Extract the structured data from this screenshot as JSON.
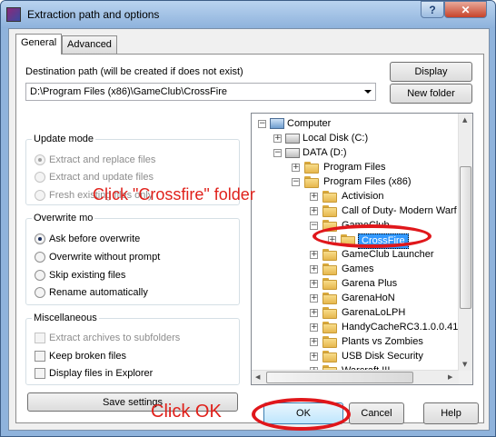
{
  "window": {
    "title": "Extraction path and options",
    "help_label": "?",
    "close_label": "✕"
  },
  "tabs": [
    {
      "label": "General",
      "active": true
    },
    {
      "label": "Advanced",
      "active": false
    }
  ],
  "destination": {
    "label": "Destination path (will be created if does not exist)",
    "value": "D:\\Program Files (x86)\\GameClub\\CrossFire"
  },
  "buttons": {
    "display": "Display",
    "new_folder": "New folder",
    "save_settings": "Save settings",
    "ok": "OK",
    "cancel": "Cancel",
    "help": "Help"
  },
  "update_mode": {
    "title": "Update mode",
    "options": [
      {
        "label": "Extract and replace files",
        "selected": true,
        "enabled": false
      },
      {
        "label": "Extract and update files",
        "selected": false,
        "enabled": false
      },
      {
        "label": "Fresh existing files only",
        "selected": false,
        "enabled": false
      }
    ]
  },
  "overwrite_mode": {
    "title": "Overwrite mo",
    "options": [
      {
        "label": "Ask before overwrite",
        "selected": true
      },
      {
        "label": "Overwrite without prompt",
        "selected": false
      },
      {
        "label": "Skip existing files",
        "selected": false
      },
      {
        "label": "Rename automatically",
        "selected": false
      }
    ]
  },
  "miscellaneous": {
    "title": "Miscellaneous",
    "options": [
      {
        "label": "Extract archives to subfolders",
        "checked": false,
        "enabled": false
      },
      {
        "label": "Keep broken files",
        "checked": false,
        "enabled": true
      },
      {
        "label": "Display files in Explorer",
        "checked": false,
        "enabled": true
      }
    ]
  },
  "tree": {
    "items": [
      {
        "label": "Computer",
        "icon": "computer-icon"
      },
      {
        "label": "Local Disk (C:)",
        "icon": "drive-icon"
      },
      {
        "label": "DATA (D:)",
        "icon": "drive-icon"
      },
      {
        "label": "Program Files",
        "icon": "folder-icon"
      },
      {
        "label": "Program Files (x86)",
        "icon": "folder-icon"
      },
      {
        "label": "Activision",
        "icon": "folder-icon"
      },
      {
        "label": "Call of Duty- Modern Warf",
        "icon": "folder-icon"
      },
      {
        "label": "GameClub",
        "icon": "folder-icon"
      },
      {
        "label": "CrossFire",
        "icon": "folder-icon",
        "selected": true
      },
      {
        "label": "GameClub Launcher",
        "icon": "folder-icon"
      },
      {
        "label": "Games",
        "icon": "folder-icon"
      },
      {
        "label": "Garena Plus",
        "icon": "folder-icon"
      },
      {
        "label": "GarenaHoN",
        "icon": "folder-icon"
      },
      {
        "label": "GarenaLoLPH",
        "icon": "folder-icon"
      },
      {
        "label": "HandyCacheRC3.1.0.0.41",
        "icon": "folder-icon"
      },
      {
        "label": "Plants vs Zombies",
        "icon": "folder-icon"
      },
      {
        "label": "USB Disk Security",
        "icon": "folder-icon"
      },
      {
        "label": "Warcraft III",
        "icon": "folder-icon"
      }
    ]
  },
  "annotations": {
    "folder_hint": "Click \"Crossfire\" folder",
    "ok_hint": "Click OK",
    "color": "#e0211b"
  }
}
